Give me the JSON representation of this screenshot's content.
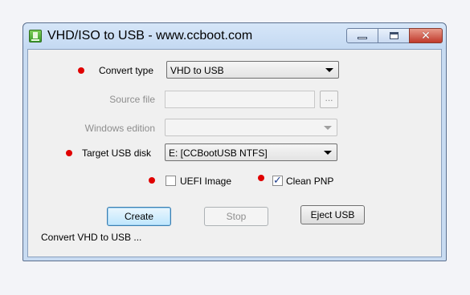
{
  "window": {
    "title": "VHD/ISO to USB - www.ccboot.com",
    "controls": {
      "minimize": "minimize",
      "maximize": "maximize",
      "close": "✕"
    }
  },
  "form": {
    "convert_type": {
      "label": "Convert type",
      "value": "VHD to USB",
      "required": true
    },
    "source_file": {
      "label": "Source file",
      "value": "",
      "browse_label": "...",
      "enabled": false
    },
    "windows_edition": {
      "label": "Windows edition",
      "value": "",
      "enabled": false
    },
    "target_usb_disk": {
      "label": "Target USB disk",
      "value": "E: [CCBootUSB NTFS]",
      "required": true
    },
    "uefi_image": {
      "label": "UEFI Image",
      "checked": false,
      "required": true
    },
    "clean_pnp": {
      "label": "Clean PNP",
      "checked": true,
      "check_glyph": "✓",
      "required": true
    }
  },
  "buttons": {
    "create": "Create",
    "stop": "Stop",
    "eject_usb": "Eject USB"
  },
  "status": {
    "text": "Convert VHD to USB ..."
  },
  "colors": {
    "required_dot": "#e00000",
    "disabled_text": "#8e8e8e"
  }
}
